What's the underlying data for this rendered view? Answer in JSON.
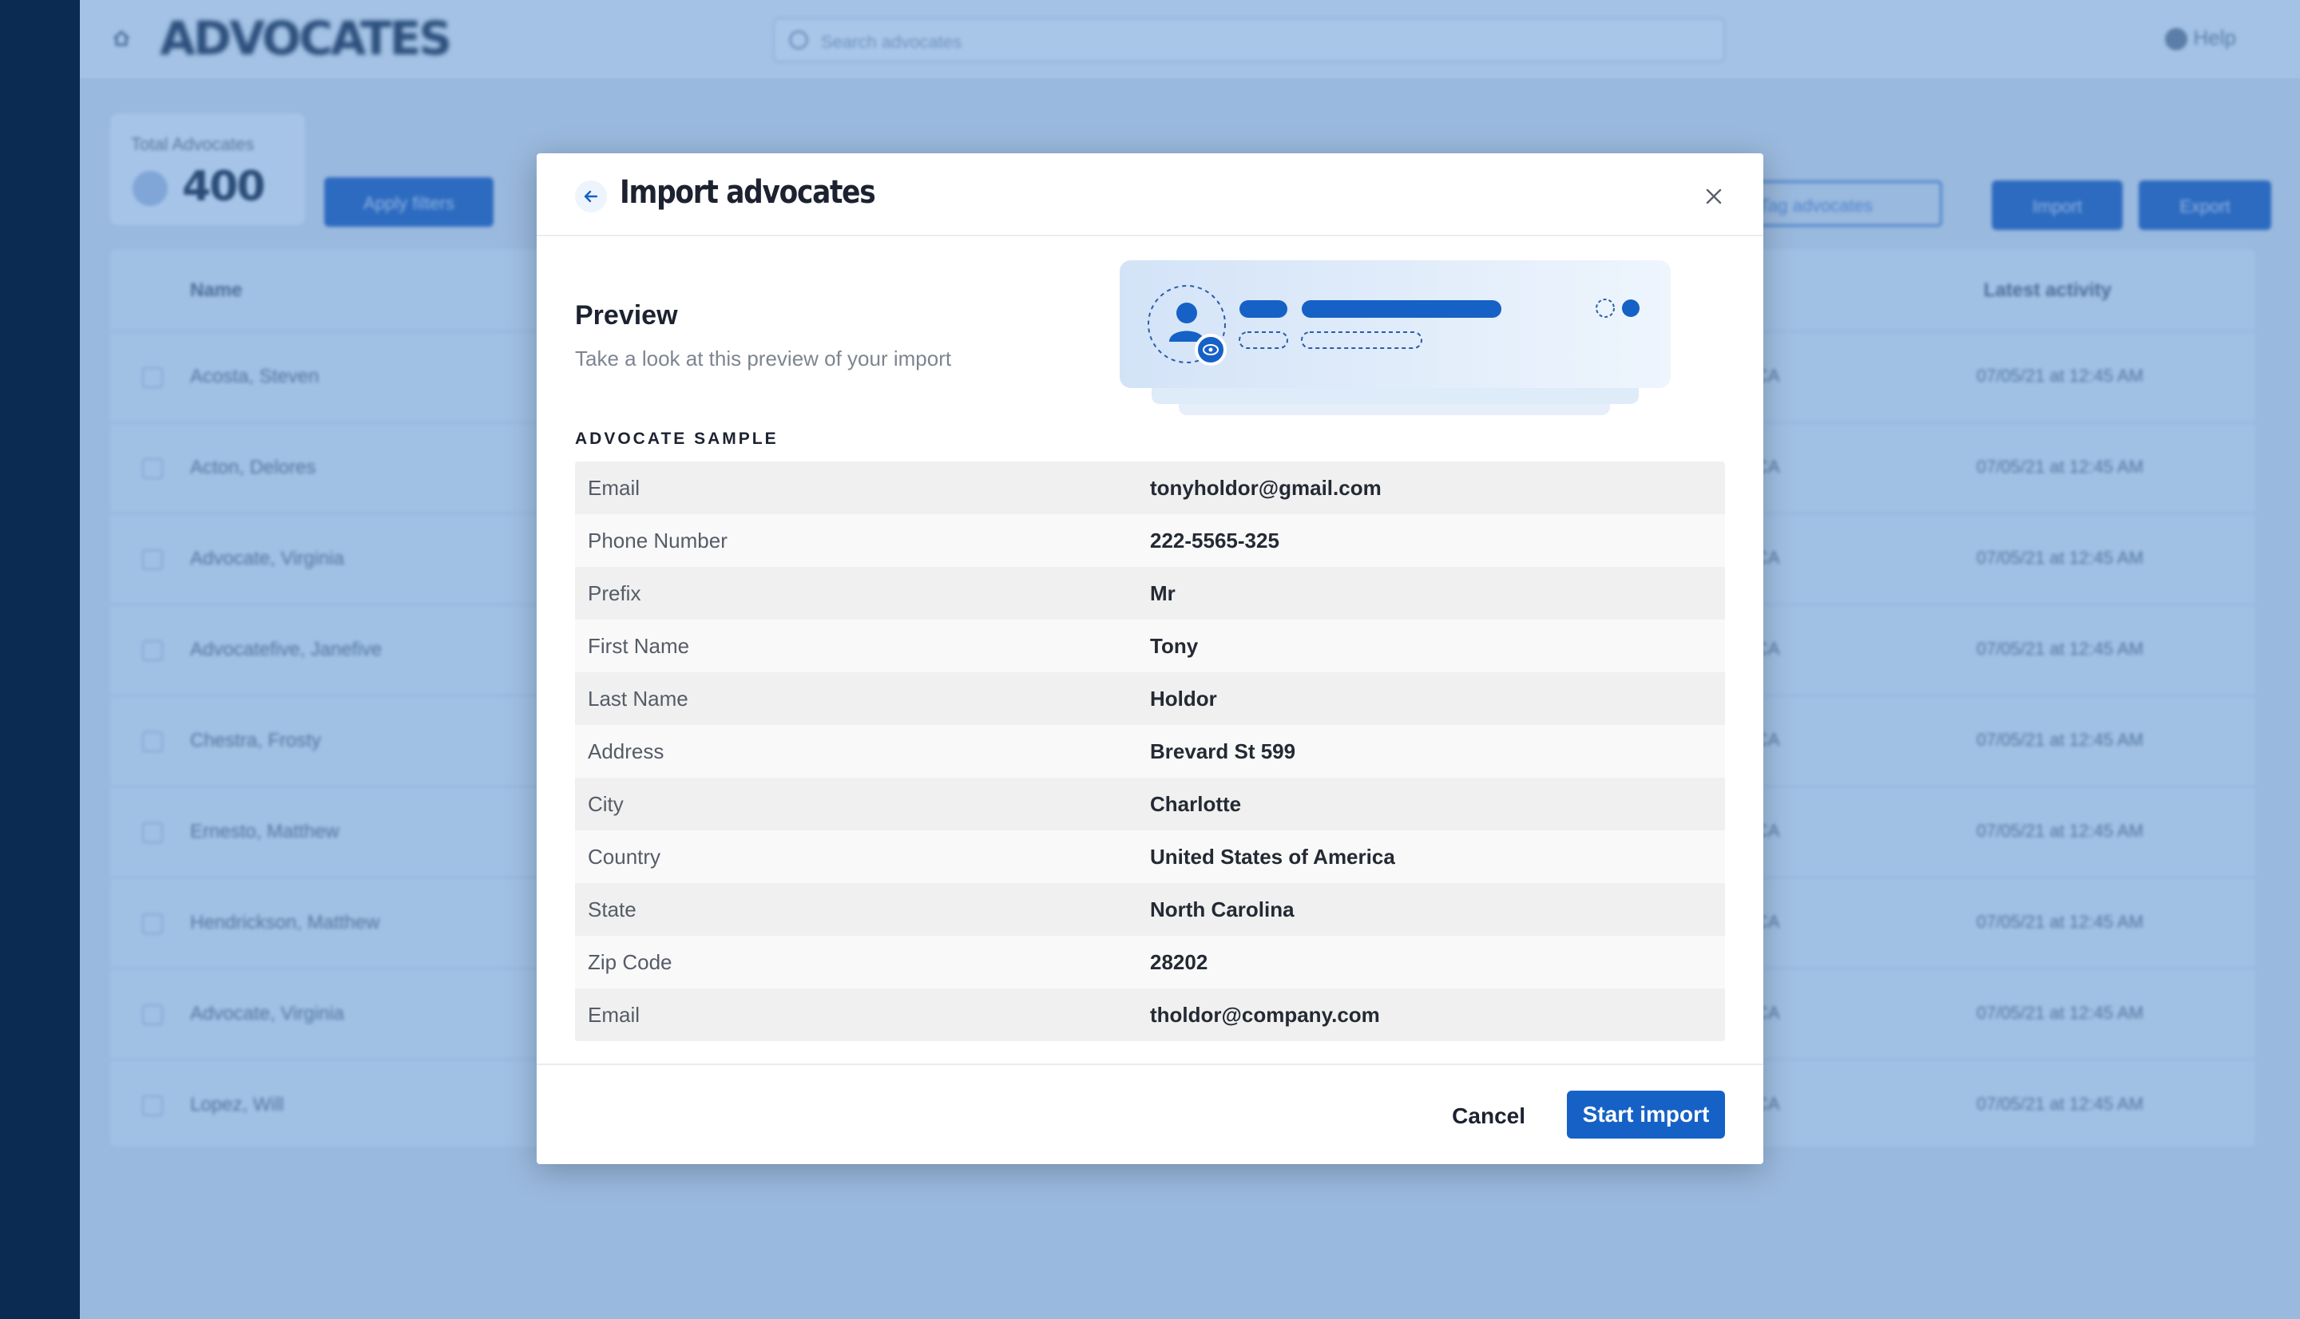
{
  "background": {
    "app_title": "ADVOCATES",
    "search_placeholder": "Search advocates",
    "help_label": "Help",
    "stat": {
      "label": "Total Advocates",
      "value": "400"
    },
    "apply_filters_label": "Apply filters",
    "tag_label": "Tag advocates",
    "import_label": "Import",
    "export_label": "Export",
    "columns": {
      "name": "Name",
      "latest_activity": "Latest activity"
    },
    "rows": [
      {
        "name": "Acosta, Steven",
        "code": "CA",
        "activity": "07/05/21 at 12:45 AM"
      },
      {
        "name": "Acton, Delores",
        "code": "CA",
        "activity": "07/05/21 at 12:45 AM"
      },
      {
        "name": "Advocate, Virginia",
        "code": "CA",
        "activity": "07/05/21 at 12:45 AM"
      },
      {
        "name": "Advocatefive, Janefive",
        "code": "CA",
        "activity": "07/05/21 at 12:45 AM"
      },
      {
        "name": "Chestra, Frosty",
        "code": "CA",
        "activity": "07/05/21 at 12:45 AM"
      },
      {
        "name": "Ernesto, Matthew",
        "code": "CA",
        "activity": "07/05/21 at 12:45 AM"
      },
      {
        "name": "Hendrickson, Matthew",
        "code": "CA",
        "activity": "07/05/21 at 12:45 AM"
      },
      {
        "name": "Advocate, Virginia",
        "code": "CA",
        "activity": "07/05/21 at 12:45 AM"
      },
      {
        "name": "Lopez, Will",
        "code": "CA",
        "activity": "07/05/21 at 12:45 AM"
      }
    ]
  },
  "modal": {
    "title": "Import advocates",
    "preview_title": "Preview",
    "preview_subtitle": "Take a look at this preview of your import",
    "sample_label": "ADVOCATE SAMPLE",
    "sample_rows": [
      {
        "field": "Email",
        "value": "tonyholdor@gmail.com"
      },
      {
        "field": "Phone Number",
        "value": "222-5565-325"
      },
      {
        "field": "Prefix",
        "value": "Mr"
      },
      {
        "field": "First Name",
        "value": "Tony"
      },
      {
        "field": "Last Name",
        "value": "Holdor"
      },
      {
        "field": "Address",
        "value": "Brevard St 599"
      },
      {
        "field": "City",
        "value": "Charlotte"
      },
      {
        "field": "Country",
        "value": "United States of America"
      },
      {
        "field": "State",
        "value": "North Carolina"
      },
      {
        "field": "Zip Code",
        "value": "28202"
      },
      {
        "field": "Email",
        "value": "tholdor@company.com"
      }
    ],
    "cancel_label": "Cancel",
    "start_label": "Start import"
  },
  "colors": {
    "primary": "#1661c6",
    "sidebar": "#0b2b52",
    "overlay": "#9ab9de"
  },
  "icons": [
    "home-icon",
    "search-icon",
    "help-icon",
    "back-arrow-icon",
    "close-icon",
    "person-icon",
    "eye-icon"
  ]
}
